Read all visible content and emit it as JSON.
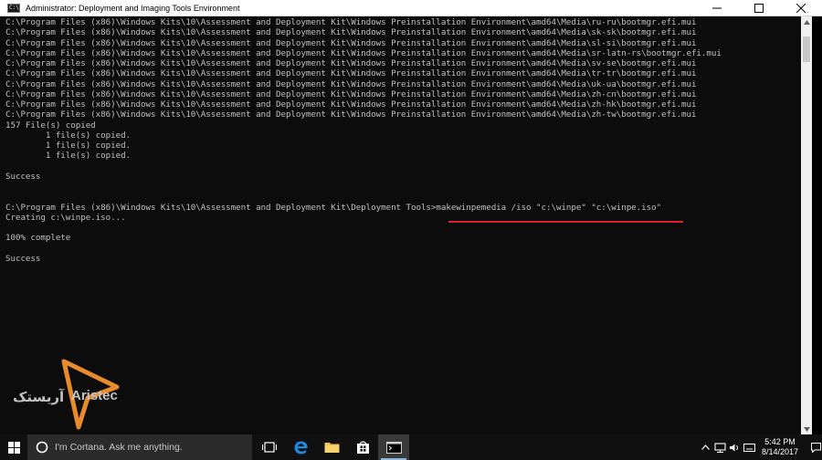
{
  "window": {
    "title": "Administrator: Deployment and Imaging Tools Environment",
    "icon_label": "C:\\"
  },
  "console": {
    "lines": [
      "C:\\Program Files (x86)\\Windows Kits\\10\\Assessment and Deployment Kit\\Windows Preinstallation Environment\\amd64\\Media\\ru-ru\\bootmgr.efi.mui",
      "C:\\Program Files (x86)\\Windows Kits\\10\\Assessment and Deployment Kit\\Windows Preinstallation Environment\\amd64\\Media\\sk-sk\\bootmgr.efi.mui",
      "C:\\Program Files (x86)\\Windows Kits\\10\\Assessment and Deployment Kit\\Windows Preinstallation Environment\\amd64\\Media\\sl-si\\bootmgr.efi.mui",
      "C:\\Program Files (x86)\\Windows Kits\\10\\Assessment and Deployment Kit\\Windows Preinstallation Environment\\amd64\\Media\\sr-latn-rs\\bootmgr.efi.mui",
      "C:\\Program Files (x86)\\Windows Kits\\10\\Assessment and Deployment Kit\\Windows Preinstallation Environment\\amd64\\Media\\sv-se\\bootmgr.efi.mui",
      "C:\\Program Files (x86)\\Windows Kits\\10\\Assessment and Deployment Kit\\Windows Preinstallation Environment\\amd64\\Media\\tr-tr\\bootmgr.efi.mui",
      "C:\\Program Files (x86)\\Windows Kits\\10\\Assessment and Deployment Kit\\Windows Preinstallation Environment\\amd64\\Media\\uk-ua\\bootmgr.efi.mui",
      "C:\\Program Files (x86)\\Windows Kits\\10\\Assessment and Deployment Kit\\Windows Preinstallation Environment\\amd64\\Media\\zh-cn\\bootmgr.efi.mui",
      "C:\\Program Files (x86)\\Windows Kits\\10\\Assessment and Deployment Kit\\Windows Preinstallation Environment\\amd64\\Media\\zh-hk\\bootmgr.efi.mui",
      "C:\\Program Files (x86)\\Windows Kits\\10\\Assessment and Deployment Kit\\Windows Preinstallation Environment\\amd64\\Media\\zh-tw\\bootmgr.efi.mui",
      "157 File(s) copied",
      "        1 file(s) copied.",
      "        1 file(s) copied.",
      "        1 file(s) copied.",
      "",
      "Success",
      "",
      "",
      "C:\\Program Files (x86)\\Windows Kits\\10\\Assessment and Deployment Kit\\Deployment Tools>makewinpemedia /iso \"c:\\winpe\" \"c:\\winpe.iso\"",
      "Creating c:\\winpe.iso...",
      "",
      "100% complete",
      "",
      "Success"
    ]
  },
  "watermark": {
    "text_fa": "آریستک",
    "text_en": "Aristec"
  },
  "taskbar": {
    "search_placeholder": "I'm Cortana. Ask me anything.",
    "time": "5:42 PM",
    "date": "8/14/2017"
  },
  "colors": {
    "console_bg": "#0c0c0c",
    "console_text": "#c0c0c0",
    "highlight_underline": "#d9232b",
    "taskbar_bg": "#101010"
  }
}
